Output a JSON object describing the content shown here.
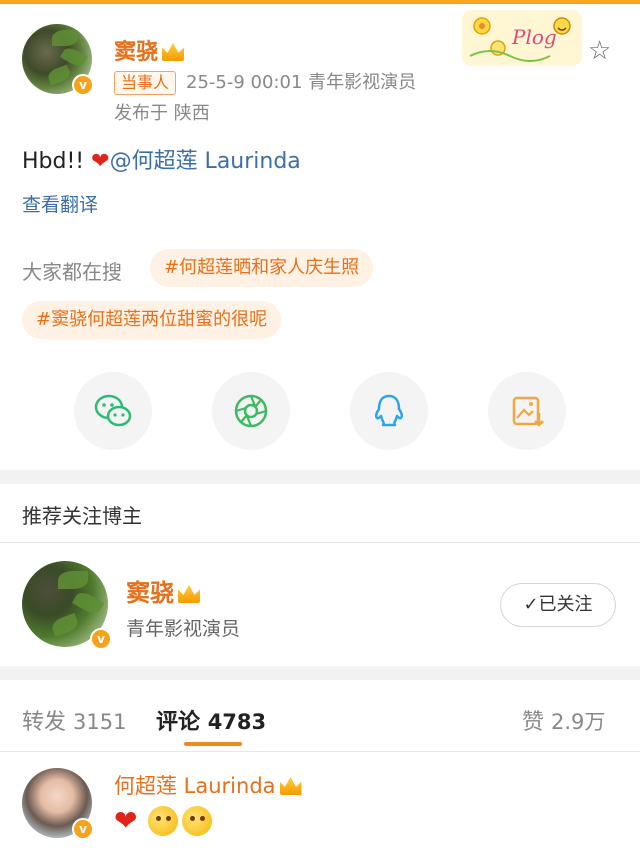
{
  "post": {
    "author": "窦骁",
    "tag": "当事人",
    "meta": "25-5-9 00:01  青年影视演员",
    "posted_from": "发布于 陕西",
    "text_prefix": "Hbd!!",
    "mention": "@何超莲 Laurinda",
    "translate": "查看翻译",
    "sticker_text": "Plog"
  },
  "search": {
    "label": "大家都在搜",
    "topics": [
      "#何超莲晒和家人庆生照",
      "#窦骁何超莲两位甜蜜的很呢"
    ]
  },
  "share": {
    "icons": [
      "wechat-icon",
      "moments-icon",
      "qq-icon",
      "save-image-icon"
    ],
    "colors": {
      "wechat": "#2dbb73",
      "moments": "#3cba62",
      "qq": "#2ea3e6",
      "save": "#f2a640"
    }
  },
  "recommend": {
    "title": "推荐关注博主",
    "name": "窦骁",
    "desc": "青年影视演员",
    "follow_label": "✓已关注"
  },
  "tabs": {
    "repost_label": "转发",
    "repost_count": "3151",
    "comment_label": "评论",
    "comment_count": "4783",
    "like_label": "赞",
    "like_count": "2.9万"
  },
  "comment": {
    "author": "何超莲 Laurinda"
  },
  "colors": {
    "accent": "#e8701a",
    "link": "#3c6ea8",
    "badge": "#f7a21b"
  }
}
